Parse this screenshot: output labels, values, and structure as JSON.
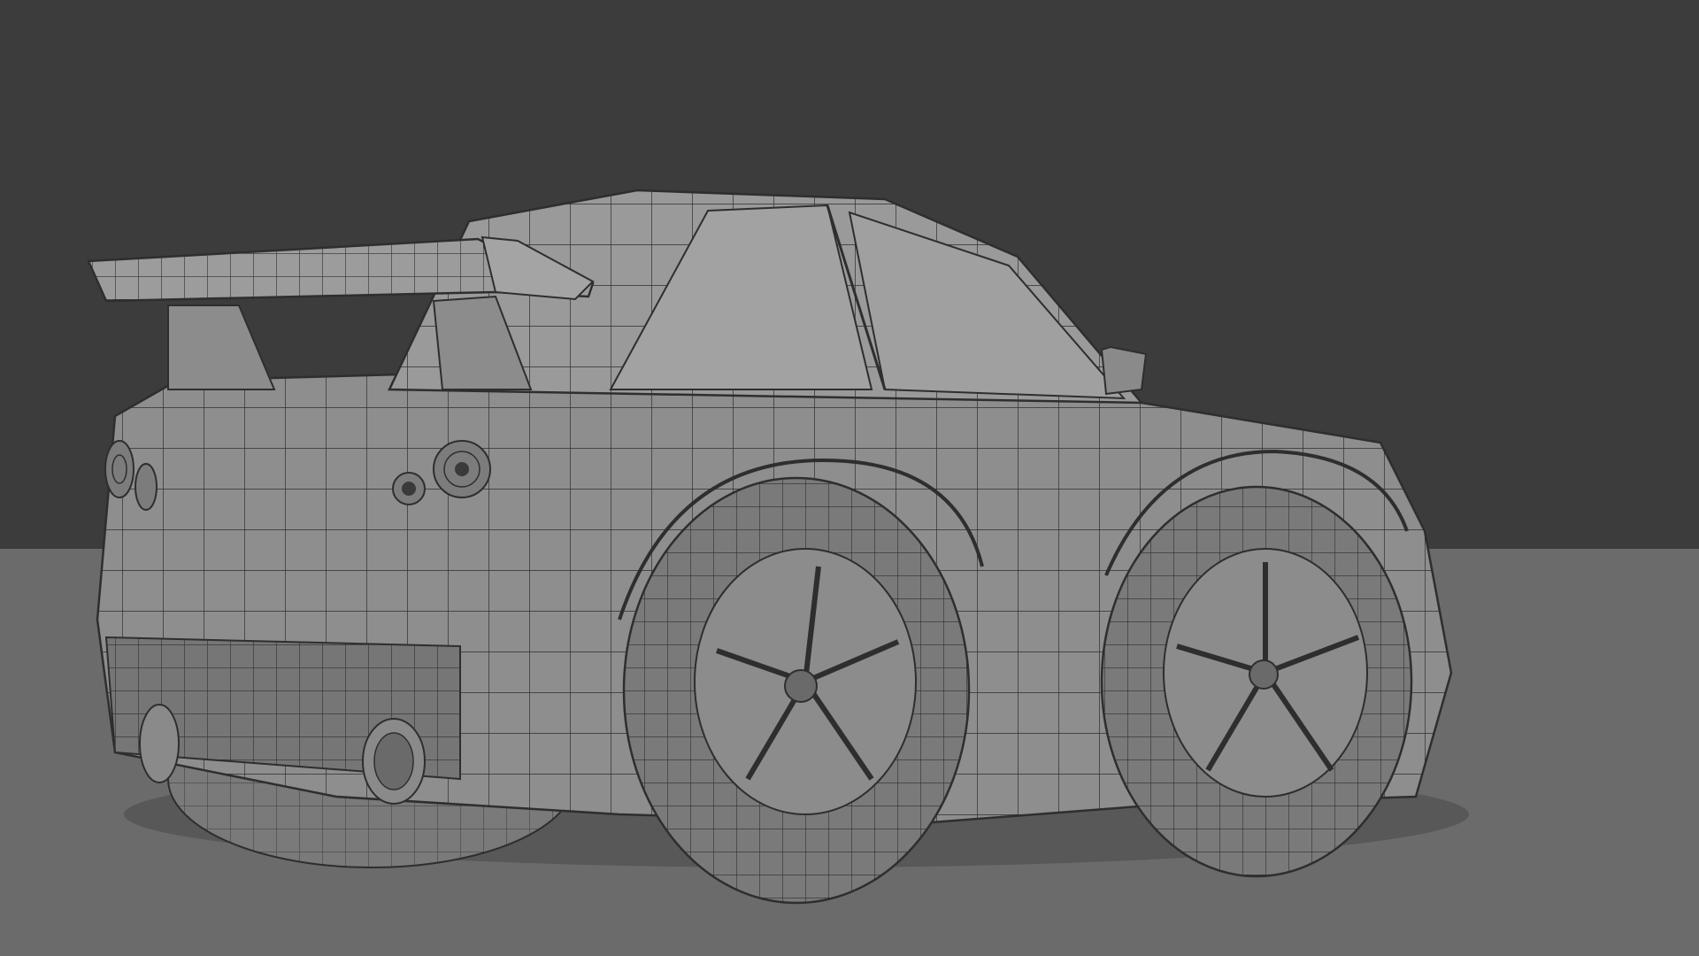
{
  "scene": {
    "subject": "car-wireframe-model",
    "colors": {
      "background": "#3c3c3c",
      "floor": "#6b6b6b",
      "body": "#8e8e8e",
      "body_dark": "#767676",
      "body_light": "#a2a2a2",
      "tire": "#7a7a7a",
      "wire": "#2e2e2e"
    }
  }
}
